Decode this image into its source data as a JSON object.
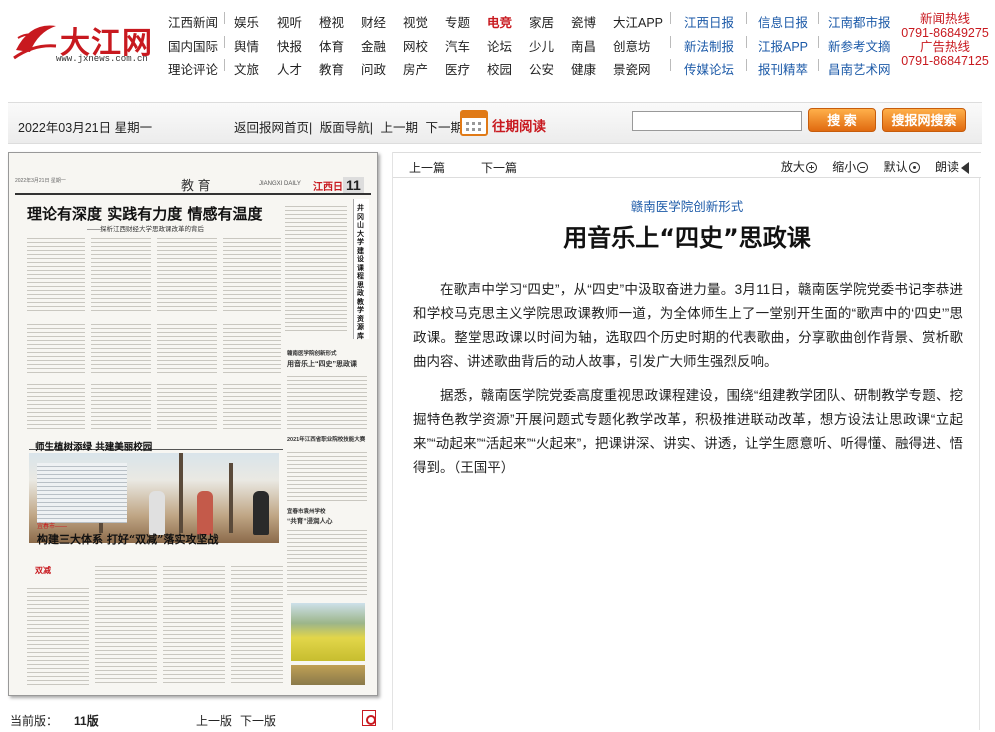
{
  "site": {
    "logo_text": "大江网",
    "logo_url": "www.jxnews.com.cn"
  },
  "nav": {
    "rows": [
      [
        "江西新闻",
        "娱乐",
        "视听",
        "橙视",
        "财经",
        "视觉",
        "专题",
        "电竞",
        "家居",
        "瓷博",
        "大江APP"
      ],
      [
        "国内国际",
        "舆情",
        "快报",
        "体育",
        "金融",
        "网校",
        "汽车",
        "论坛",
        "少儿",
        "南昌",
        "创意坊"
      ],
      [
        "理论评论",
        "文旅",
        "人才",
        "教育",
        "问政",
        "房产",
        "医疗",
        "校园",
        "公安",
        "健康",
        "景瓷网"
      ]
    ],
    "right_rows": [
      [
        "江西日报",
        "信息日报",
        "江南都市报"
      ],
      [
        "新法制报",
        "江报APP",
        "新参考文摘"
      ],
      [
        "传媒论坛",
        "报刊精萃",
        "昌南艺术网"
      ]
    ],
    "highlight": "电竞"
  },
  "hotline": {
    "news_label": "新闻热线",
    "news_number": "0791-86849275",
    "ad_label": "广告热线",
    "ad_number": "0791-86847125"
  },
  "toolbar": {
    "date": "2022年03月21日 星期一",
    "links": [
      "返回报网首页|",
      "版面导航|",
      "上一期",
      "下一期|"
    ],
    "past_read": "往期阅读",
    "search_placeholder": "",
    "search_label": "搜 索",
    "site_search_label": "搜报网搜索"
  },
  "paper": {
    "date": "2022年3月21日 星期一",
    "section": "教 育",
    "daily": "JIANGXI DAILY",
    "brand": "江西日报",
    "page_num": "11",
    "headline1": "理论有深度 实践有力度 情感有温度",
    "sub1": "——探析江西财经大学思政课改革的背后",
    "vertical_title": "井冈山大学建设课程思政教学资源库",
    "small_head1": "赣南医学院创新形式",
    "small_head2": "用音乐上“四史”思政课",
    "small_head3": "2021年江西省职业院校技能大赛",
    "small_head4": "宜春市袁州学校",
    "small_head5": "“共育”浸润人心",
    "headline2": "师生植树添绿 共建美丽校园",
    "tag3": "宜春市——",
    "headline3": "构建三大体系 打好“双减”落实攻坚战",
    "logo_shuangjian": "双减"
  },
  "left_footer": {
    "current_label": "当前版：",
    "current_value": "11版",
    "prev": "上一版",
    "next": "下一版"
  },
  "article": {
    "prev": "上一篇",
    "next": "下一篇",
    "zoom_in": "放大",
    "zoom_out": "缩小",
    "default": "默认",
    "read_aloud": "朗读",
    "kicker": "赣南医学院创新形式",
    "title": "用音乐上“四史”思政课",
    "paragraphs": [
      "在歌声中学习“四史”，从“四史”中汲取奋进力量。3月11日，赣南医学院党委书记李恭进和学校马克思主义学院思政课教师一道，为全体师生上了一堂别开生面的“歌声中的‘四史’”思政课。整堂思政课以时间为轴，选取四个历史时期的代表歌曲，分享歌曲创作背景、赏析歌曲内容、讲述歌曲背后的动人故事，引发广大师生强烈反响。",
      "据悉，赣南医学院党委高度重视思政课程建设，围绕“组建教学团队、研制教学专题、挖掘特色教学资源”开展问题式专题化教学改革，积极推进联动改革，想方设法让思政课“立起来”“动起来”“活起来”“火起来”，把课讲深、讲实、讲透，让学生愿意听、听得懂、融得进、悟得到。（王国平）"
    ]
  }
}
